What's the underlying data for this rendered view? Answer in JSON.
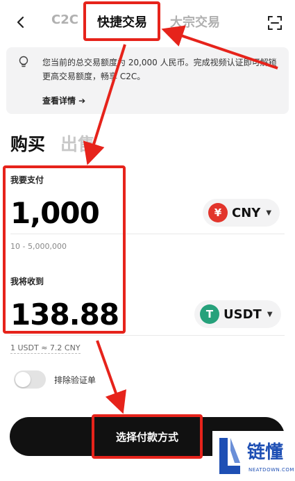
{
  "header": {
    "back_icon": "back-chevron-icon",
    "tabs": [
      {
        "label": "C2C"
      },
      {
        "label": "快捷交易",
        "active": true
      },
      {
        "label": "大宗交易"
      }
    ],
    "scan_icon": "scan-icon"
  },
  "notice": {
    "icon": "lightbulb-icon",
    "text": "您当前的总交易额度为 20,000 人民币。完成视频认证即可解锁更高交易额度，畅享 C2C。",
    "link_label": "查看详情 ➔"
  },
  "side_tabs": {
    "buy": "购买",
    "sell": "出售",
    "active": "buy"
  },
  "pay": {
    "label": "我要支付",
    "amount": "1,000",
    "currency": "CNY",
    "currency_symbol": "¥",
    "currency_color": "#e2352c",
    "range": "10 - 5,000,000"
  },
  "receive": {
    "label": "我将收到",
    "amount": "138.88",
    "currency": "USDT",
    "currency_symbol": "T",
    "currency_color": "#26a17b"
  },
  "rate": "1 USDT ≈ 7.2 CNY",
  "toggle": {
    "label": "排除验证单",
    "on": false
  },
  "cta": {
    "label": "选择付款方式"
  },
  "annotation_color": "#e6231b",
  "watermark": {
    "text": "链懂",
    "sub": "NEATDOWN.COM"
  }
}
